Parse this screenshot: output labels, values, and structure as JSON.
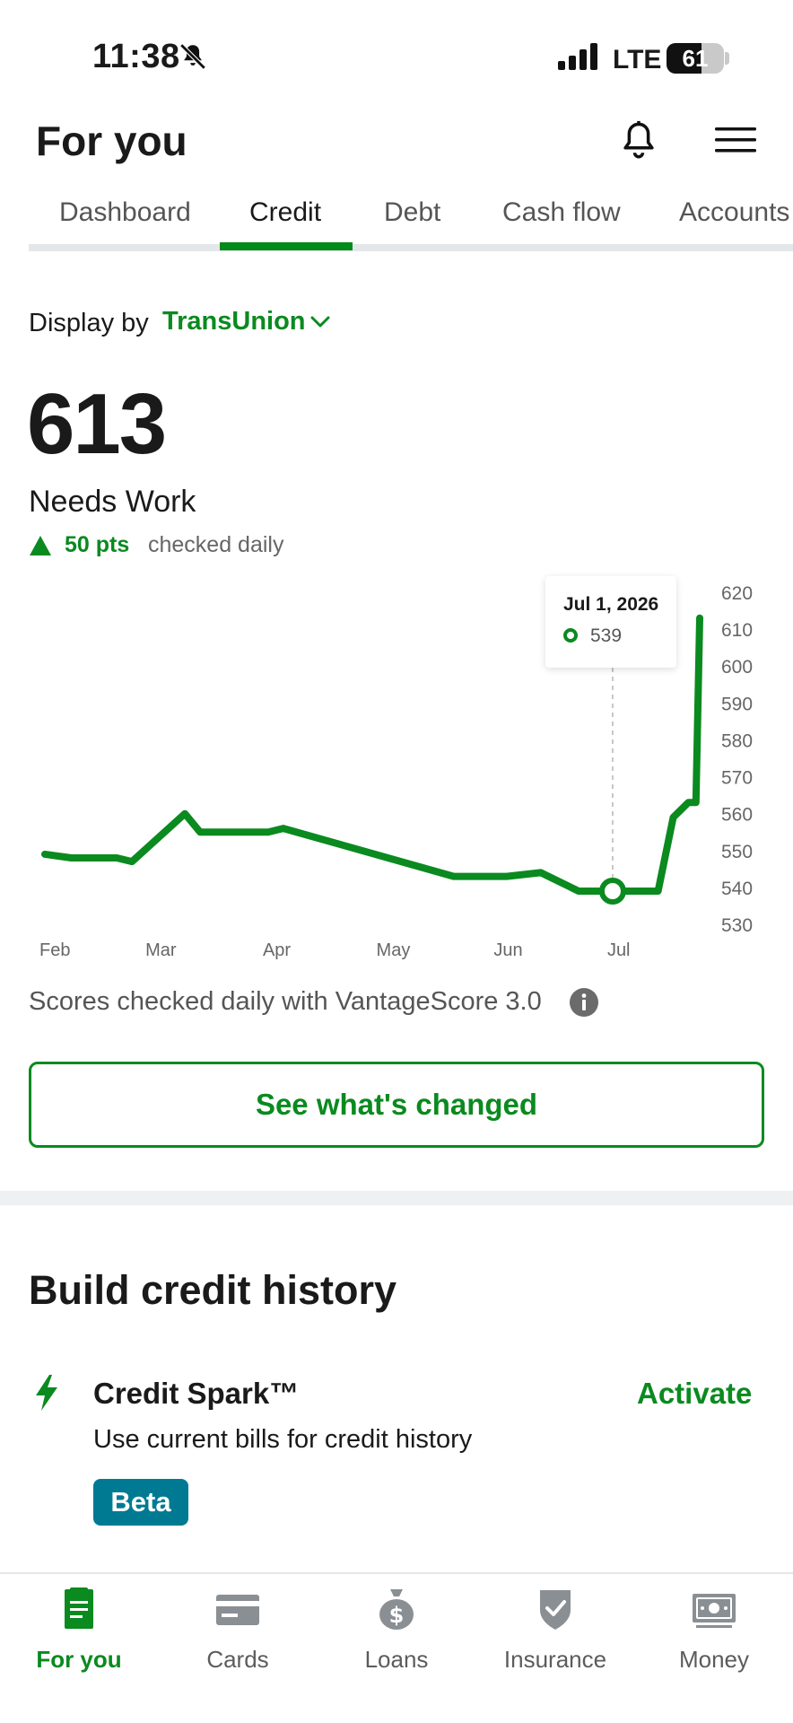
{
  "status_bar": {
    "time": "11:38",
    "network": "LTE",
    "battery": "61",
    "battery_level": 0.61
  },
  "header": {
    "title": "For you"
  },
  "tabs": [
    {
      "label": "Dashboard",
      "active": false
    },
    {
      "label": "Credit",
      "active": true
    },
    {
      "label": "Debt",
      "active": false
    },
    {
      "label": "Cash flow",
      "active": false
    },
    {
      "label": "Accounts",
      "active": false
    }
  ],
  "display_by": {
    "label": "Display by",
    "bureau": "TransUnion"
  },
  "score": {
    "value": "613",
    "rating": "Needs Work",
    "change": "50 pts",
    "note": "checked daily"
  },
  "tooltip": {
    "date": "Jul 1, 2026",
    "value": "539"
  },
  "chart_data": {
    "type": "line",
    "x_ticks": [
      "Feb",
      "Mar",
      "Apr",
      "May",
      "Jun",
      "Jul"
    ],
    "y_ticks": [
      "620",
      "610",
      "600",
      "590",
      "580",
      "570",
      "560",
      "550",
      "540",
      "530"
    ],
    "ylim": [
      530,
      620
    ],
    "series": [
      {
        "points": [
          {
            "x": "2026-02-01",
            "y": 549
          },
          {
            "x": "2026-02-08",
            "y": 548
          },
          {
            "x": "2026-02-20",
            "y": 548
          },
          {
            "x": "2026-02-24",
            "y": 547
          },
          {
            "x": "2026-03-10",
            "y": 560
          },
          {
            "x": "2026-03-14",
            "y": 555
          },
          {
            "x": "2026-04-01",
            "y": 555
          },
          {
            "x": "2026-04-05",
            "y": 556
          },
          {
            "x": "2026-05-20",
            "y": 543
          },
          {
            "x": "2026-06-03",
            "y": 543
          },
          {
            "x": "2026-06-12",
            "y": 544
          },
          {
            "x": "2026-06-22",
            "y": 539
          },
          {
            "x": "2026-07-01",
            "y": 539
          },
          {
            "x": "2026-07-13",
            "y": 539
          },
          {
            "x": "2026-07-17",
            "y": 559
          },
          {
            "x": "2026-07-21",
            "y": 563
          },
          {
            "x": "2026-07-23",
            "y": 563
          },
          {
            "x": "2026-07-24",
            "y": 613
          }
        ]
      }
    ],
    "highlight": {
      "x": "2026-07-01",
      "y": 539
    },
    "grid": false,
    "color": "#0a8a1f"
  },
  "vantage_note": "Scores checked daily with VantageScore 3.0",
  "cta_label": "See what's changed",
  "section": {
    "title": "Build credit history",
    "item_name": "Credit Spark™",
    "item_action": "Activate",
    "item_desc": "Use current bills for credit history",
    "item_badge": "Beta"
  },
  "bottom_nav": [
    {
      "label": "For you",
      "icon": "document-icon",
      "active": true
    },
    {
      "label": "Cards",
      "icon": "card-icon",
      "active": false
    },
    {
      "label": "Loans",
      "icon": "money-bag-icon",
      "active": false
    },
    {
      "label": "Insurance",
      "icon": "shield-icon",
      "active": false
    },
    {
      "label": "Money",
      "icon": "cash-icon",
      "active": false
    }
  ],
  "colors": {
    "accent": "#0a8a1f",
    "badge": "#007a93"
  }
}
